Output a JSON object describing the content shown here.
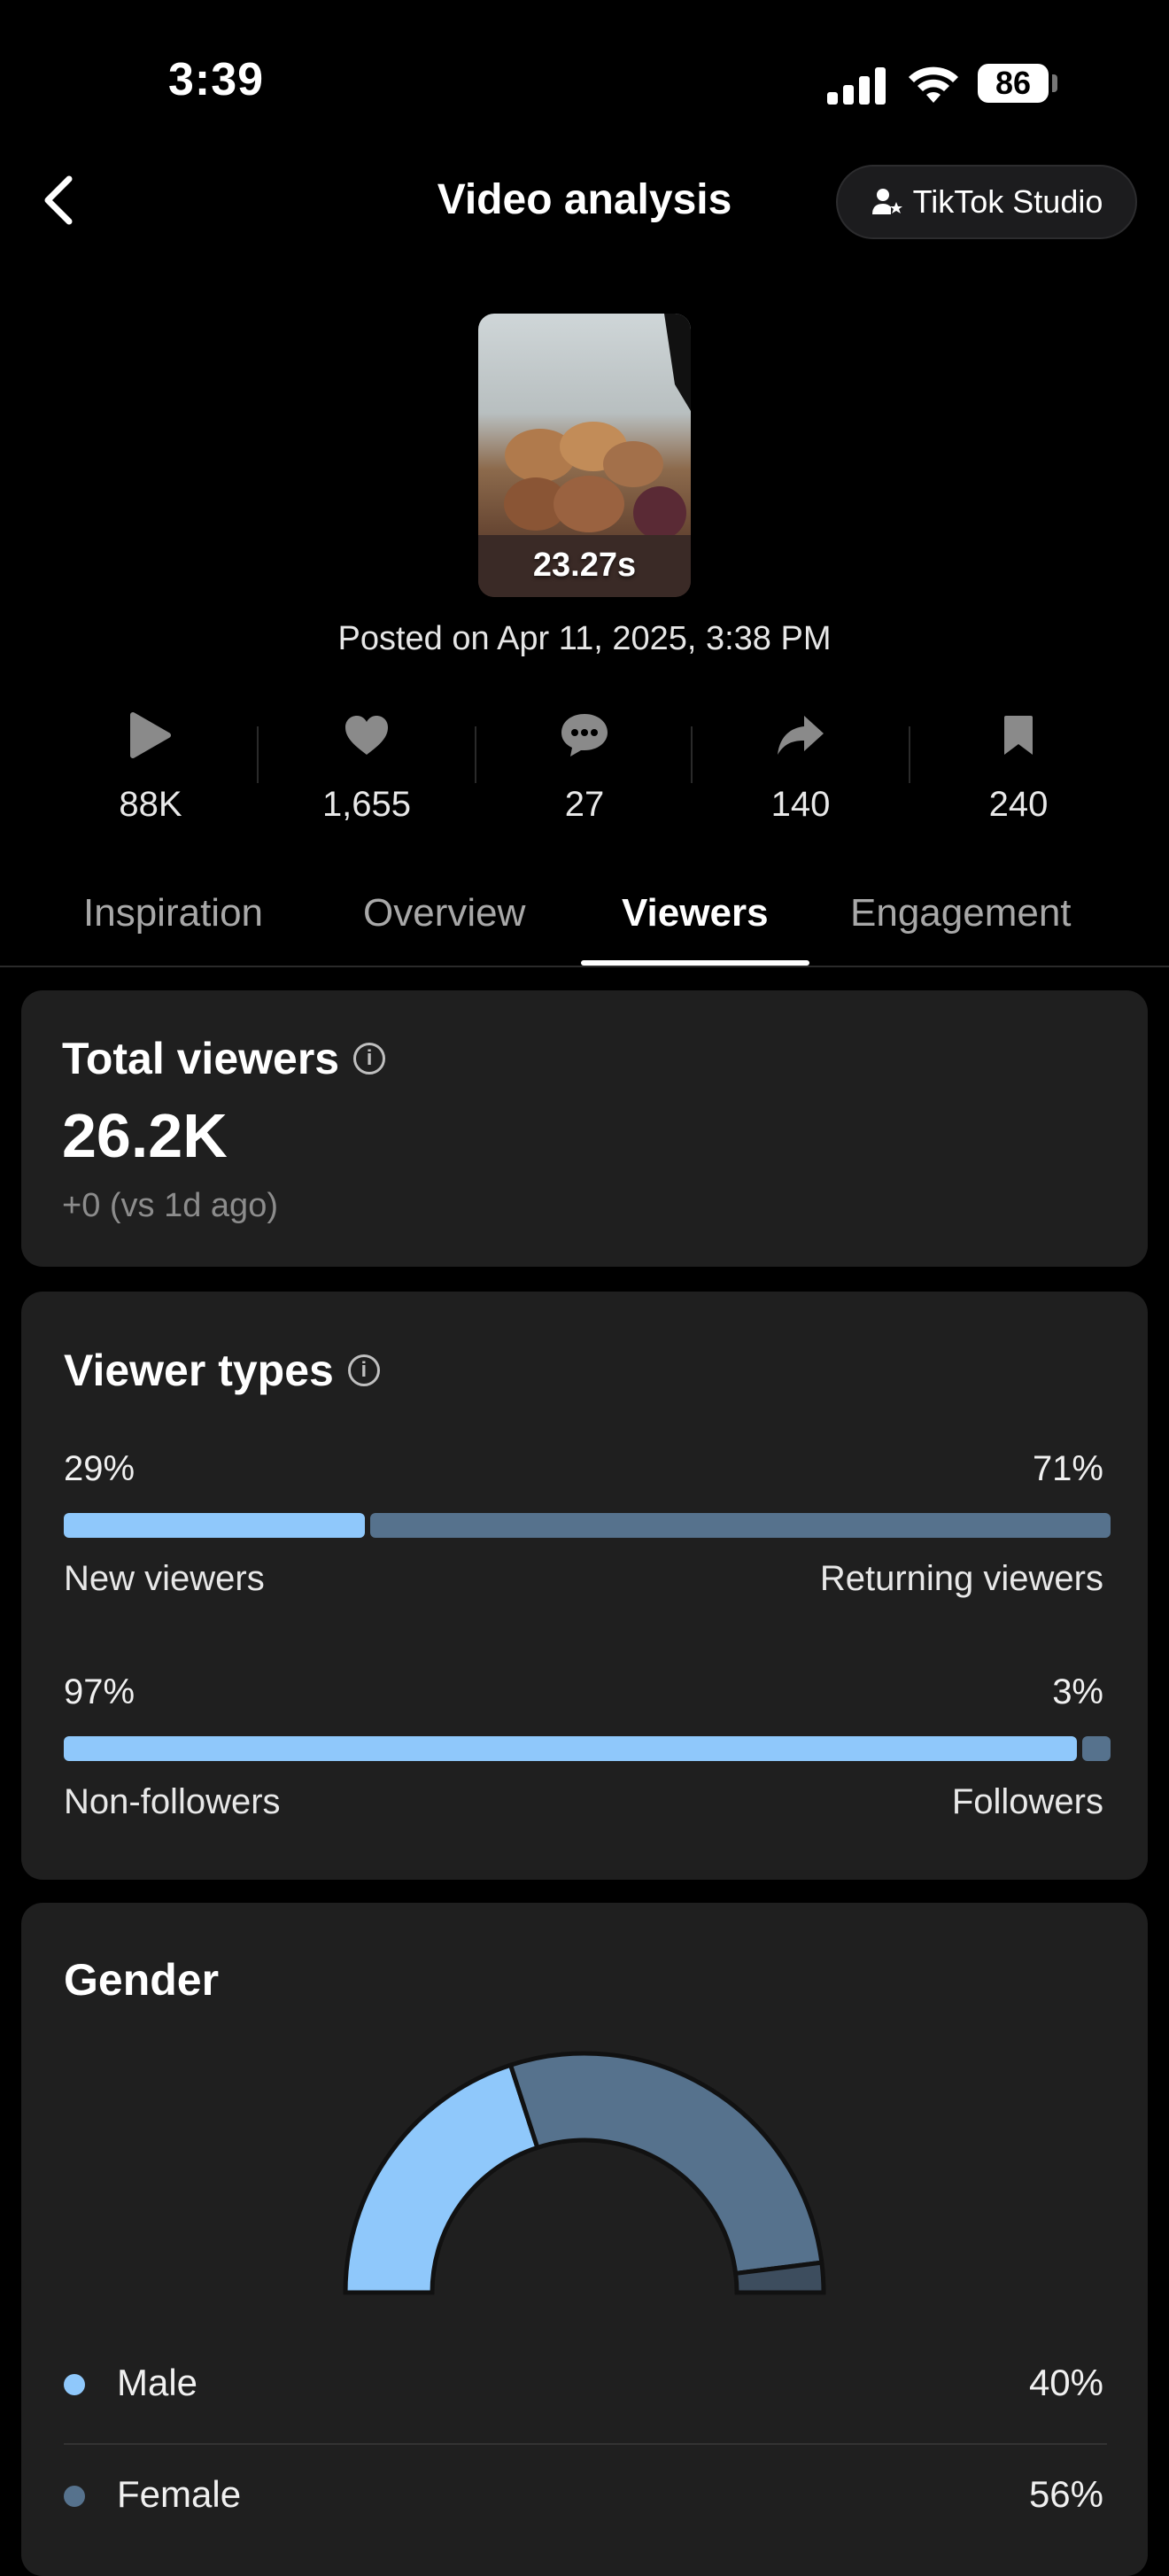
{
  "status_bar": {
    "time": "3:39",
    "battery": "86"
  },
  "header": {
    "title": "Video analysis",
    "studio_button": "TikTok Studio"
  },
  "video": {
    "duration": "23.27s",
    "posted": "Posted on Apr 11, 2025, 3:38 PM"
  },
  "stats": [
    {
      "icon": "play-icon",
      "value": "88K"
    },
    {
      "icon": "heart-icon",
      "value": "1,655"
    },
    {
      "icon": "comment-icon",
      "value": "27"
    },
    {
      "icon": "share-icon",
      "value": "140"
    },
    {
      "icon": "bookmark-icon",
      "value": "240"
    }
  ],
  "tabs": [
    {
      "label": "Inspiration",
      "active": false
    },
    {
      "label": "Overview",
      "active": false
    },
    {
      "label": "Viewers",
      "active": true
    },
    {
      "label": "Engagement",
      "active": false
    }
  ],
  "total_viewers": {
    "title": "Total viewers",
    "value": "26.2K",
    "change": "+0  (vs 1d ago)"
  },
  "viewer_types": {
    "title": "Viewer types",
    "new_vs_returning": {
      "left_pct": "29%",
      "right_pct": "71%",
      "left_label": "New viewers",
      "right_label": "Returning viewers",
      "left_fraction": 0.29
    },
    "followers": {
      "left_pct": "97%",
      "right_pct": "3%",
      "left_label": "Non-followers",
      "right_label": "Followers",
      "left_fraction": 0.97
    }
  },
  "gender": {
    "title": "Gender",
    "items": [
      {
        "name": "Male",
        "value": "40%",
        "color": "#8fc8fb"
      },
      {
        "name": "Female",
        "value": "56%",
        "color": "#56728d"
      }
    ],
    "chart_data": {
      "type": "pie",
      "categories": [
        "Male",
        "Female",
        "Other"
      ],
      "values": [
        40,
        56,
        4
      ]
    }
  },
  "colors": {
    "light_blue": "#8fc8fb",
    "slate": "#56728d",
    "card": "#1f1f1f"
  }
}
